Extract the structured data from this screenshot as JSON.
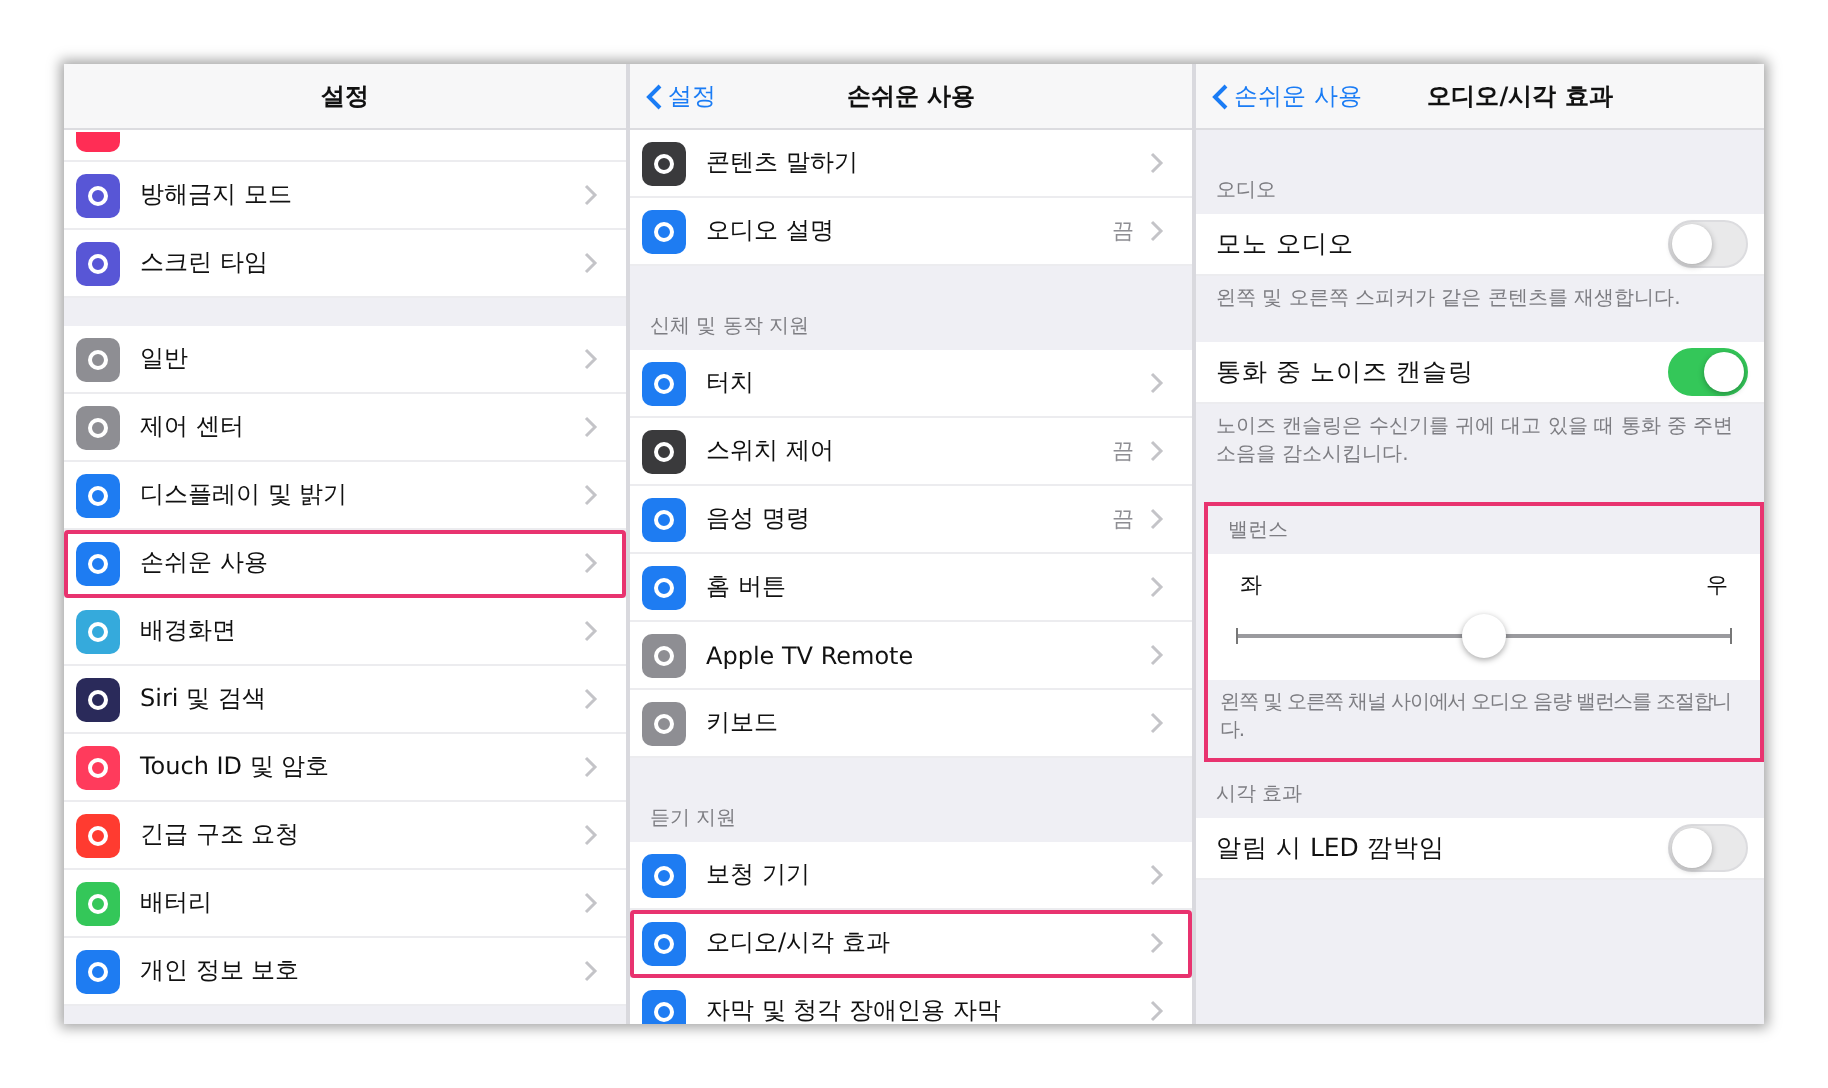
{
  "panels": [
    {
      "title": "설정",
      "items": [
        {
          "kind": "cut",
          "color": "#ff2d55"
        },
        {
          "kind": "row",
          "label": "방해금지 모드",
          "color": "#5856d6",
          "highlighted": false
        },
        {
          "kind": "row",
          "label": "스크린 타임",
          "color": "#5856d6",
          "highlighted": false
        },
        {
          "kind": "spacer"
        },
        {
          "kind": "row",
          "label": "일반",
          "color": "#8e8e93",
          "highlighted": false
        },
        {
          "kind": "row",
          "label": "제어 센터",
          "color": "#8e8e93",
          "highlighted": false
        },
        {
          "kind": "row",
          "label": "디스플레이 및 밝기",
          "color": "#1e7cf2",
          "highlighted": false
        },
        {
          "kind": "row",
          "label": "손쉬운 사용",
          "color": "#1e7cf2",
          "highlighted": true
        },
        {
          "kind": "row",
          "label": "배경화면",
          "color": "#35aadc",
          "highlighted": false
        },
        {
          "kind": "row",
          "label": "Siri 및 검색",
          "color": "#2a2a5a",
          "highlighted": false
        },
        {
          "kind": "row",
          "label": "Touch ID 및 암호",
          "color": "#ff3b5c",
          "highlighted": false
        },
        {
          "kind": "row",
          "label": "긴급 구조 요청",
          "color": "#ff3b30",
          "highlighted": false
        },
        {
          "kind": "row",
          "label": "배터리",
          "color": "#34c759",
          "highlighted": false
        },
        {
          "kind": "row",
          "label": "개인 정보 보호",
          "color": "#1e7cf2",
          "highlighted": false
        }
      ]
    },
    {
      "back": "설정",
      "title": "손쉬운 사용",
      "items": [
        {
          "kind": "row",
          "label": "콘텐츠 말하기",
          "color": "#3a3a3c",
          "highlighted": false
        },
        {
          "kind": "row",
          "label": "오디오 설명",
          "value": "끔",
          "color": "#1e7cf2",
          "highlighted": false
        },
        {
          "kind": "spacer"
        },
        {
          "kind": "section_header",
          "label": "신체 및 동작 지원"
        },
        {
          "kind": "row",
          "label": "터치",
          "color": "#1e7cf2",
          "highlighted": false
        },
        {
          "kind": "row",
          "label": "스위치 제어",
          "value": "끔",
          "color": "#3a3a3c",
          "highlighted": false
        },
        {
          "kind": "row",
          "label": "음성 명령",
          "value": "끔",
          "color": "#1e7cf2",
          "highlighted": false
        },
        {
          "kind": "row",
          "label": "홈 버튼",
          "color": "#1e7cf2",
          "highlighted": false
        },
        {
          "kind": "row",
          "label": "Apple TV Remote",
          "color": "#8e8e93",
          "highlighted": false
        },
        {
          "kind": "row",
          "label": "키보드",
          "color": "#8e8e93",
          "highlighted": false
        },
        {
          "kind": "spacer"
        },
        {
          "kind": "section_header",
          "label": "듣기 지원"
        },
        {
          "kind": "row",
          "label": "보청 기기",
          "color": "#1e7cf2",
          "highlighted": false
        },
        {
          "kind": "row",
          "label": "오디오/시각 효과",
          "color": "#1e7cf2",
          "highlighted": true
        },
        {
          "kind": "row",
          "label": "자막 및 청각 장애인용 자막",
          "color": "#1e7cf2",
          "highlighted": false
        }
      ]
    },
    {
      "back": "손쉬운 사용",
      "title": "오디오/시각 효과",
      "items": [
        {
          "kind": "spacer"
        },
        {
          "kind": "section_header",
          "label": "오디오"
        },
        {
          "kind": "toggle",
          "label": "모노 오디오",
          "on": false
        },
        {
          "kind": "footer",
          "label": "왼쪽 및 오른쪽 스피커가 같은 콘텐츠를 재생합니다."
        },
        {
          "kind": "toggle",
          "label": "통화 중 노이즈 캔슬링",
          "on": true
        },
        {
          "kind": "footer",
          "label": "노이즈 캔슬링은 수신기를 귀에 대고 있을 때 통화 중 주변 소음을 감소시킵니다."
        },
        {
          "kind": "balance",
          "title": "밸런스",
          "left": "좌",
          "right": "우",
          "level": 0.5,
          "note": "왼쪽 및 오른쪽 채널 사이에서 오디오 음량 밸런스를 조절합니다.",
          "highlighted": true
        },
        {
          "kind": "section_header",
          "label": "시각 효과"
        },
        {
          "kind": "toggle",
          "label": "알림 시 LED 깜박임",
          "on": false
        }
      ]
    }
  ]
}
